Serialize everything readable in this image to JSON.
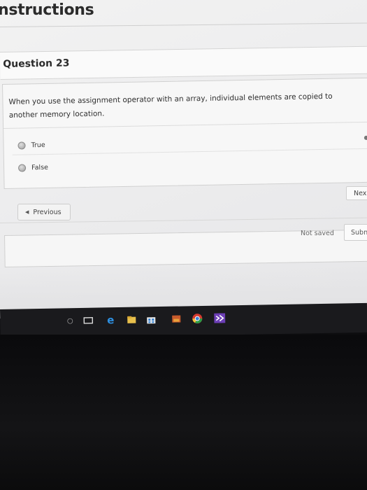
{
  "page": {
    "title": "nstructions"
  },
  "question": {
    "number_label": "Question 23",
    "text": "When you use the assignment operator with an array, individual elements are copied to another memory location.",
    "options": [
      {
        "label": "True",
        "selected": false
      },
      {
        "label": "False",
        "selected": false
      }
    ]
  },
  "navigation": {
    "next_label": "Nex",
    "previous_label": "Previous",
    "previous_icon": "chevron-left-icon"
  },
  "footer": {
    "save_status": "Not saved",
    "submit_label": "Subn"
  },
  "taskbar": {
    "icons": [
      "task-view-icon",
      "edge-browser-icon",
      "file-explorer-icon",
      "store-icon",
      "photos-icon",
      "chrome-icon",
      "visual-studio-icon"
    ]
  }
}
